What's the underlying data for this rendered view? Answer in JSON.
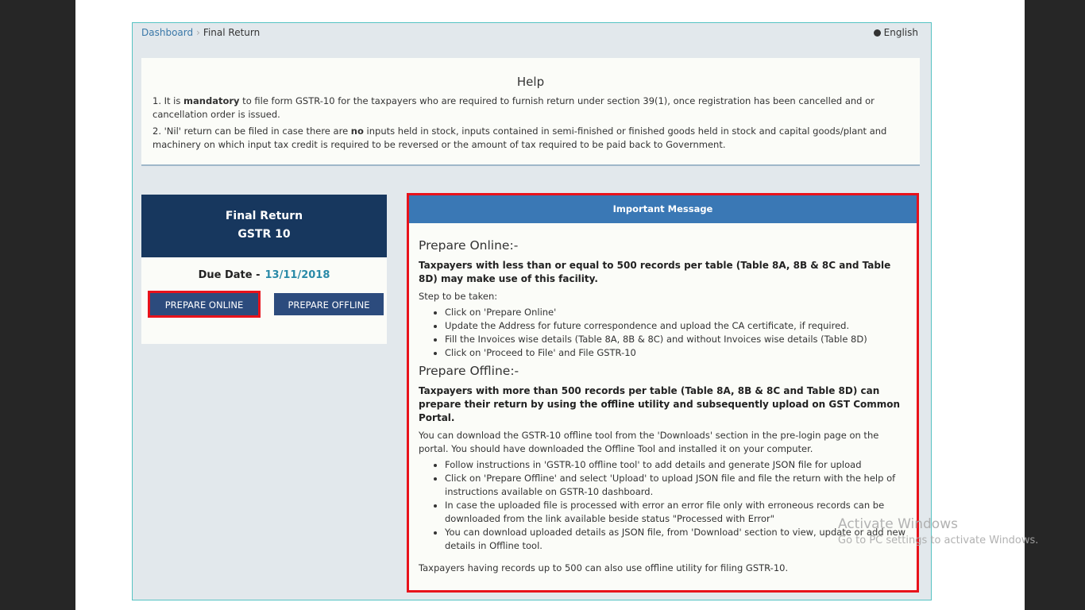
{
  "breadcrumb": {
    "home": "Dashboard",
    "separator": "›",
    "current": "Final Return"
  },
  "language": {
    "label": "English"
  },
  "help": {
    "title": "Help",
    "items": [
      {
        "num": "1. It is ",
        "strong": "mandatory",
        "rest": " to file form GSTR-10 for the taxpayers who are required to furnish return under section 39(1), once registration has been cancelled and or cancellation order is issued."
      },
      {
        "num": "2. 'Nil' return can be filed in case there are ",
        "strong": "no",
        "rest": " inputs held in stock, inputs contained in semi-finished or finished goods held in stock and capital goods/plant and machinery on which input tax credit is required to be reversed or the amount of tax required to be paid back to Government."
      }
    ]
  },
  "card": {
    "title": "Final Return",
    "subtitle": "GSTR 10",
    "due_label": "Due Date -",
    "due_date": "13/11/2018",
    "prepare_online": "PREPARE ONLINE",
    "prepare_offline": "PREPARE OFFLINE"
  },
  "message": {
    "header": "Important Message",
    "online_heading": "Prepare Online:-",
    "online_bold": "Taxpayers with less than or equal to 500 records per table (Table 8A, 8B & 8C and Table 8D) may make use of this facility.",
    "steps_label": "Step to be taken:",
    "online_steps": [
      "Click on 'Prepare Online'",
      "Update the Address for future correspondence and upload the CA certificate, if required.",
      "Fill the Invoices wise details (Table 8A, 8B & 8C) and without Invoices wise details (Table 8D)",
      "Click on 'Proceed to File' and File GSTR-10"
    ],
    "offline_heading": "Prepare Offline:-",
    "offline_bold": "Taxpayers with more than 500 records per table (Table 8A, 8B & 8C and Table 8D) can prepare their return by using the offline utility and subsequently upload on GST Common Portal.",
    "offline_intro": "You can download the GSTR-10 offline tool from the 'Downloads' section in the pre-login page on the portal. You should have downloaded the Offline Tool and installed it on your computer.",
    "offline_steps": [
      "Follow instructions in 'GSTR-10 offline tool' to add details and generate JSON file for upload",
      "Click on 'Prepare Offline' and select 'Upload' to upload JSON file and file the return with the help of instructions available on GSTR-10 dashboard.",
      "In case the uploaded file is processed with error an error file only with erroneous records can be downloaded from the link available beside status \"Processed with Error\"",
      "You can download uploaded details as JSON file, from 'Download' section to view, update or add new details in Offline tool."
    ],
    "footer": "Taxpayers having records up to 500 can also use offline utility for filing GSTR-10."
  },
  "watermark": {
    "line1": "Activate Windows",
    "line2": "Go to PC settings to activate Windows."
  }
}
